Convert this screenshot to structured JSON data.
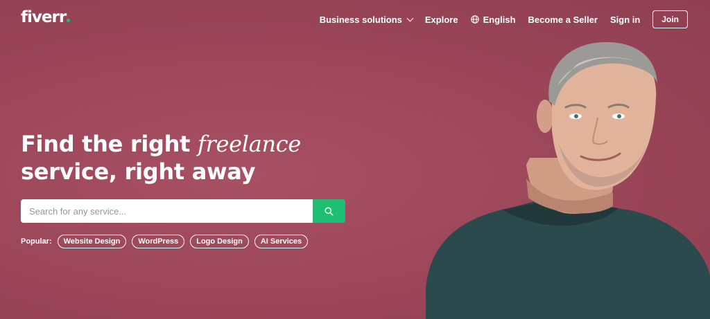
{
  "brand": {
    "logo_text": "fiverr",
    "dot_color": "#1dbf73",
    "background_color": "#9c4759"
  },
  "nav": {
    "business_solutions": "Business solutions",
    "explore": "Explore",
    "language": "English",
    "become_seller": "Become a Seller",
    "sign_in": "Sign in",
    "join": "Join"
  },
  "hero": {
    "headline_part1": "Find the right ",
    "headline_italic": "freelance",
    "headline_part2": "service, right away"
  },
  "search": {
    "placeholder": "Search for any service...",
    "value": "",
    "button_color": "#1dbf73"
  },
  "popular": {
    "label": "Popular:",
    "tags": [
      "Website Design",
      "WordPress",
      "Logo Design",
      "AI Services"
    ]
  },
  "icons": {
    "chevron": "chevron-down-icon",
    "globe": "globe-icon",
    "search": "search-icon"
  }
}
